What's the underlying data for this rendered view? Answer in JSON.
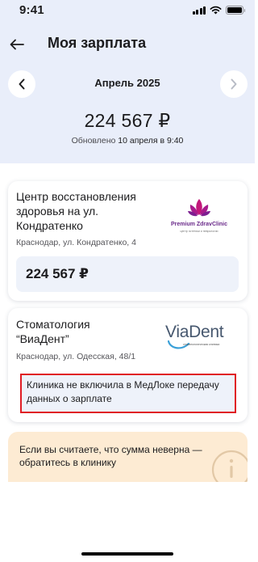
{
  "status_bar": {
    "time": "9:41"
  },
  "header": {
    "title": "Моя зарплата"
  },
  "period": {
    "month": "Апрель 2025"
  },
  "summary": {
    "total": "224 567 ₽",
    "updated_prefix": "Обновлено",
    "updated_date": "10 апреля в 9:40"
  },
  "clinics": [
    {
      "name": "Центр восстановления здоровья на ул. Кондратенко",
      "address": "Краснодар, ул. Кондратенко, 4",
      "logo_text": "Premium ZdravClinic",
      "logo_subtext": "центр эстетики и неврологии",
      "amount": "224 567 ₽"
    },
    {
      "name": "Стоматология “ВиаДент”",
      "address": "Краснодар, ул. Одесская, 48/1",
      "logo_text": "ViaDent",
      "logo_subtext": "стоматологическая клиника",
      "notice": "Клиника не включила в МедЛоке передачу данных о зарплате"
    }
  ],
  "info": {
    "text": "Если вы считаете, что сумма неверна — обратитесь в клинику"
  },
  "colors": {
    "header_bg": "#e9eefa",
    "highlight": "#e01c24",
    "info_bg": "#fdebd3",
    "amount_bg": "#eef2fa"
  }
}
